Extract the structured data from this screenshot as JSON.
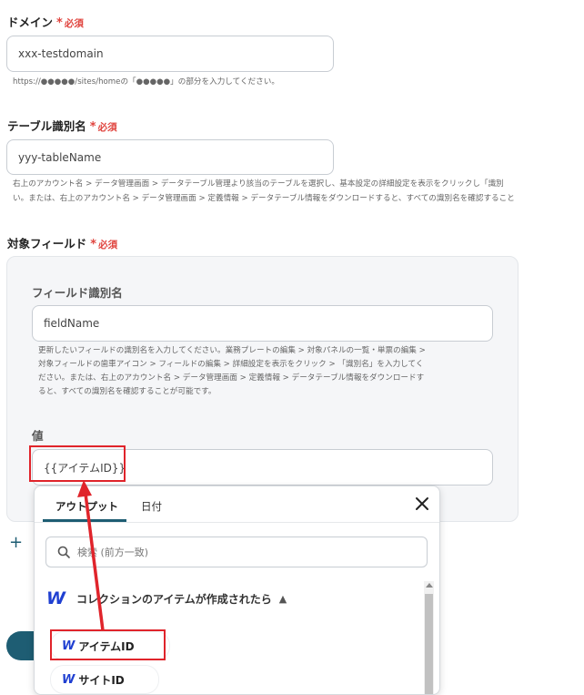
{
  "domain_field": {
    "label": "ドメイン",
    "required": "必須",
    "value": "xxx-testdomain",
    "help": "https://●●●●●/sites/homeの「●●●●●」の部分を入力してください。"
  },
  "table_field": {
    "label": "テーブル識別名",
    "required": "必須",
    "value": "yyy-tableName",
    "help_lines": [
      "右上のアカウント名 > データ管理画面 > データテーブル管理より該当のテーブルを選択し、基本設定の詳細設定を表示をクリックし「識別",
      "い。または、右上のアカウント名 > データ管理画面 > 定義情報 > データテーブル情報をダウンロードすると、すべての識別名を確認すること"
    ]
  },
  "target_fields": {
    "label": "対象フィールド",
    "required": "必須",
    "field_id_label": "フィールド識別名",
    "field_id_value": "fieldName",
    "field_id_help_lines": [
      "更新したいフィールドの識別名を入力してください。業務プレートの編集 > 対象パネルの一覧・単票の編集 >",
      "対象フィールドの歯車アイコン > フィールドの編集 > 詳細設定を表示をクリック > 「識別名」を入力してく",
      "ださい。または、右上のアカウント名 > データ管理画面 > 定義情報 > データテーブル情報をダウンロードす",
      "ると、すべての識別名を確認することが可能です。"
    ],
    "value_label": "値",
    "value_value": "{{アイテムID}}",
    "add_icon": "plus-icon"
  },
  "popup": {
    "tabs": [
      "アウトプット",
      "日付"
    ],
    "active_tab": "アウトプット",
    "search_placeholder": "検索 (前方一致)",
    "group_title": "コレクションのアイテムが作成されたら",
    "items": [
      "アイテムID",
      "サイトID"
    ],
    "logo_glyph": "W"
  },
  "colors": {
    "required": "#e0443e",
    "highlight": "#e0242b",
    "tab_underline": "#1e5d73",
    "webflow_blue": "#1f3fd1"
  }
}
